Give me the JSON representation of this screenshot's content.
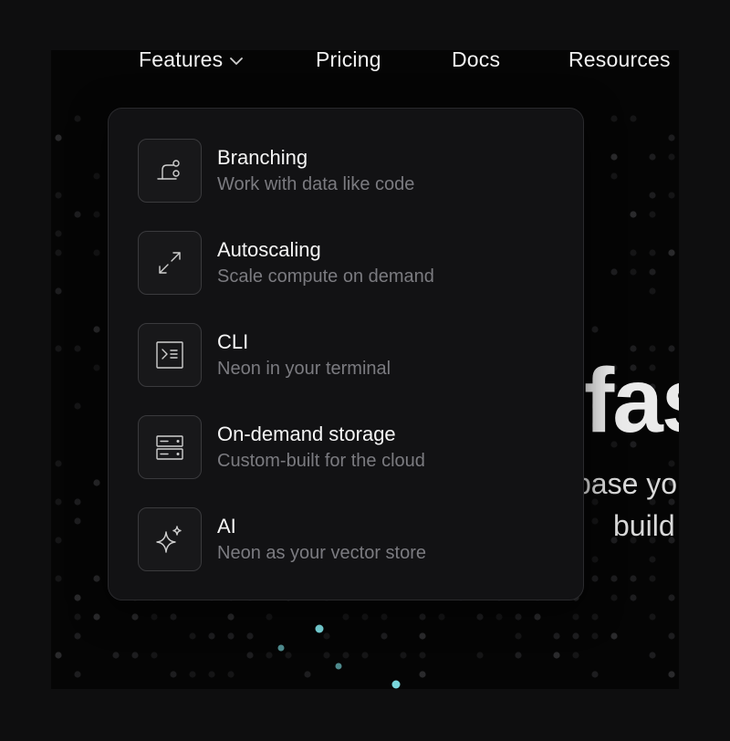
{
  "nav": {
    "items": [
      {
        "label": "Features",
        "has_dropdown": true
      },
      {
        "label": "Pricing"
      },
      {
        "label": "Docs"
      },
      {
        "label": "Resources"
      }
    ]
  },
  "hero": {
    "title_fragment": "fas",
    "subtitle_line1_fragment": "base you",
    "subtitle_line2_fragment": "build"
  },
  "dropdown": {
    "items": [
      {
        "title": "Branching",
        "description": "Work with data like code",
        "icon": "branch-icon"
      },
      {
        "title": "Autoscaling",
        "description": "Scale compute on demand",
        "icon": "expand-arrows-icon"
      },
      {
        "title": "CLI",
        "description": "Neon in your terminal",
        "icon": "terminal-icon"
      },
      {
        "title": "On-demand storage",
        "description": "Custom-built for the cloud",
        "icon": "storage-icon"
      },
      {
        "title": "AI",
        "description": "Neon as your vector store",
        "icon": "sparkles-icon"
      }
    ]
  },
  "colors": {
    "background": "#050505",
    "dropdown_bg": "#121214",
    "text_primary": "#f5f5f5",
    "text_secondary": "#7b7b80",
    "accent_dot": "#7fe3e8"
  }
}
